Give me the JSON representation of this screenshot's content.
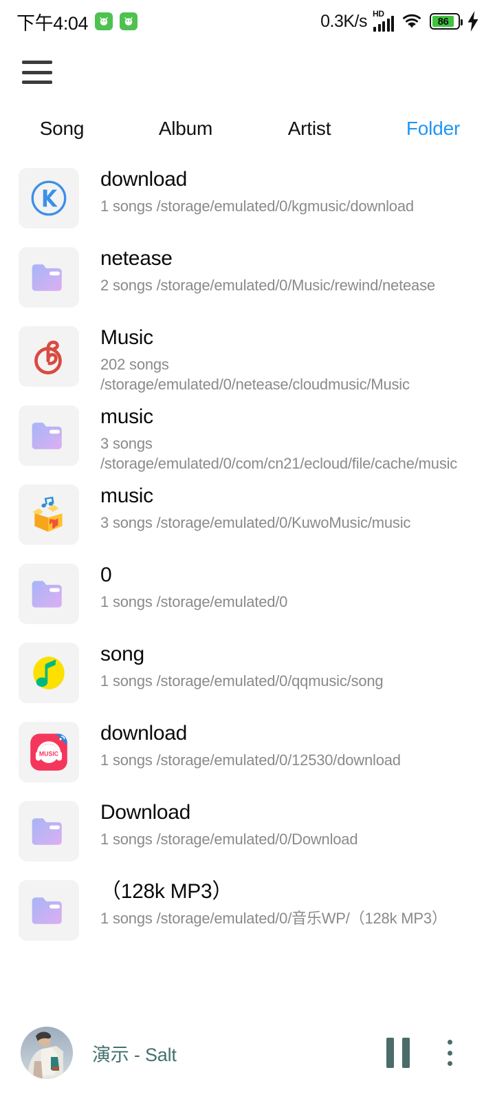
{
  "status_bar": {
    "time": "下午4:04",
    "network_speed": "0.3K/s",
    "hd_label": "HD",
    "battery_level": "86",
    "notification_icons": [
      "android-notification-icon",
      "android-notification-icon"
    ],
    "icons": [
      "signal-icon",
      "wifi-icon",
      "battery-icon",
      "charging-bolt-icon"
    ]
  },
  "top_bar": {
    "menu_icon": "hamburger-menu-icon"
  },
  "tabs": [
    {
      "label": "Song",
      "active": false
    },
    {
      "label": "Album",
      "active": false
    },
    {
      "label": "Artist",
      "active": false
    },
    {
      "label": "Folder",
      "active": true
    }
  ],
  "accent_color": "#2196f3",
  "player_text_color": "#44706e",
  "folders": [
    {
      "name": "download",
      "info": "1 songs /storage/emulated/0/kgmusic/download",
      "icon": "kugou-music-icon"
    },
    {
      "name": "netease",
      "info": "2 songs /storage/emulated/0/Music/rewind/netease",
      "icon": "folder-icon"
    },
    {
      "name": "Music",
      "info": "202 songs /storage/emulated/0/netease/cloudmusic/Music",
      "icon": "netease-cloud-music-icon"
    },
    {
      "name": "music",
      "info": "3 songs /storage/emulated/0/com/cn21/ecloud/file/cache/music",
      "icon": "folder-icon"
    },
    {
      "name": "music",
      "info": "3 songs /storage/emulated/0/KuwoMusic/music",
      "icon": "kuwo-music-icon"
    },
    {
      "name": "0",
      "info": "1 songs /storage/emulated/0",
      "icon": "folder-icon"
    },
    {
      "name": "song",
      "info": "1 songs /storage/emulated/0/qqmusic/song",
      "icon": "qq-music-icon"
    },
    {
      "name": "download",
      "info": "1 songs /storage/emulated/0/12530/download",
      "icon": "migu-music-icon"
    },
    {
      "name": "Download",
      "info": "1 songs /storage/emulated/0/Download",
      "icon": "folder-icon"
    },
    {
      "name": "（128k MP3）",
      "info": "1 songs /storage/emulated/0/音乐WP/（128k MP3）",
      "icon": "folder-icon"
    }
  ],
  "player": {
    "now_playing": "演示 - Salt",
    "album_art": "album-art-thumbnail",
    "pause_icon": "pause-icon",
    "queue_icon": "playlist-queue-icon"
  }
}
